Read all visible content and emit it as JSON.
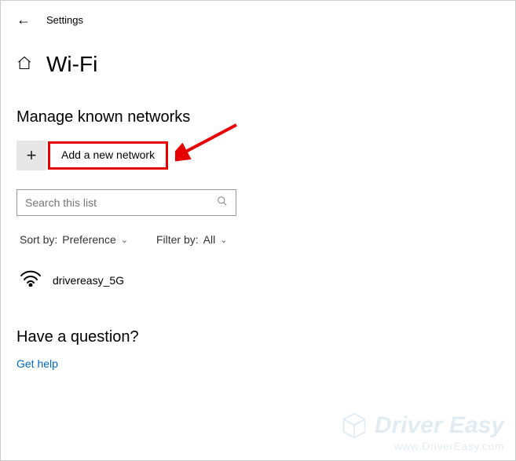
{
  "header": {
    "title": "Settings"
  },
  "page": {
    "title": "Wi-Fi"
  },
  "section": {
    "heading": "Manage known networks"
  },
  "add_network": {
    "label": "Add a new network"
  },
  "search": {
    "placeholder": "Search this list"
  },
  "sort": {
    "prefix": "Sort by:",
    "value": "Preference"
  },
  "filter": {
    "prefix": "Filter by:",
    "value": "All"
  },
  "networks": [
    {
      "name": "drivereasy_5G"
    }
  ],
  "question": {
    "heading": "Have a question?",
    "help": "Get help"
  },
  "watermark": {
    "brand": "Driver Easy",
    "url": "www.DriverEasy.com"
  }
}
